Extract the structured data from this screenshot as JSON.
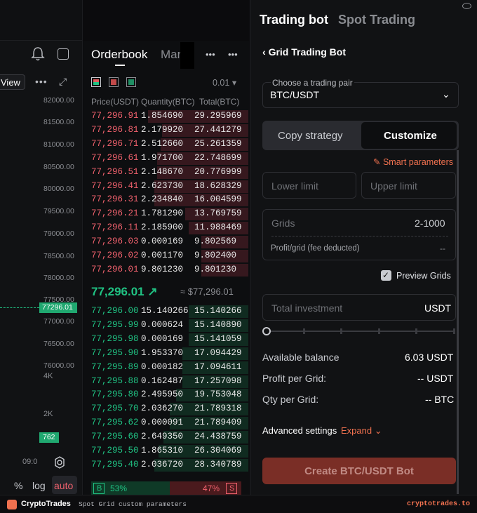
{
  "chart": {
    "view_label": "View",
    "price_labels": [
      "82000.00",
      "81500.00",
      "81000.00",
      "80500.00",
      "80000.00",
      "79500.00",
      "79000.00",
      "78500.00",
      "78000.00",
      "77500.00",
      "77000.00",
      "76500.00",
      "76000.00"
    ],
    "current_tag": "77296.01",
    "volume_labels": [
      "4K",
      "2K"
    ],
    "volume_tag": "762",
    "time_label": "09:0",
    "scale_buttons": [
      "%",
      "log",
      "auto"
    ]
  },
  "orderbook": {
    "tab_active": "Orderbook",
    "tab_other": "Mark",
    "precision": "0.01",
    "columns": [
      "Price(USDT)",
      "Quantity(BTC)",
      "Total(BTC)"
    ],
    "asks": [
      {
        "price": "77,296.91",
        "qty": "1.854690",
        "total": "29.295969",
        "depth": 0.64
      },
      {
        "price": "77,296.81",
        "qty": "2.179920",
        "total": "27.441279",
        "depth": 0.55
      },
      {
        "price": "77,296.71",
        "qty": "2.512660",
        "total": "25.261359",
        "depth": 0.56
      },
      {
        "price": "77,296.61",
        "qty": "1.971700",
        "total": "22.748699",
        "depth": 0.58
      },
      {
        "price": "77,296.51",
        "qty": "2.148670",
        "total": "20.776999",
        "depth": 0.58
      },
      {
        "price": "77,296.41",
        "qty": "2.623730",
        "total": "18.628329",
        "depth": 0.6
      },
      {
        "price": "77,296.31",
        "qty": "2.234840",
        "total": "16.004599",
        "depth": 0.6
      },
      {
        "price": "77,296.21",
        "qty": "1.781290",
        "total": "13.769759",
        "depth": 0.4
      },
      {
        "price": "77,296.11",
        "qty": "2.185900",
        "total": "11.988469",
        "depth": 0.38
      },
      {
        "price": "77,296.03",
        "qty": "0.000169",
        "total": "9.802569",
        "depth": 0.3
      },
      {
        "price": "77,296.02",
        "qty": "0.001170",
        "total": "9.802400",
        "depth": 0.3
      },
      {
        "price": "77,296.01",
        "qty": "9.801230",
        "total": "9.801230",
        "depth": 0.3
      }
    ],
    "last_price": "77,296.01",
    "last_arrow": "↗",
    "last_usd": "≈ $77,296.01",
    "bids": [
      {
        "price": "77,296.00",
        "qty": "15.140266",
        "total": "15.140266",
        "depth": 0.38
      },
      {
        "price": "77,295.99",
        "qty": "0.000624",
        "total": "15.140890",
        "depth": 0.38
      },
      {
        "price": "77,295.98",
        "qty": "0.000169",
        "total": "15.141059",
        "depth": 0.38
      },
      {
        "price": "77,295.90",
        "qty": "1.953370",
        "total": "17.094429",
        "depth": 0.42
      },
      {
        "price": "77,295.89",
        "qty": "0.000182",
        "total": "17.094611",
        "depth": 0.42
      },
      {
        "price": "77,295.88",
        "qty": "0.162487",
        "total": "17.257098",
        "depth": 0.42
      },
      {
        "price": "77,295.80",
        "qty": "2.495950",
        "total": "19.753048",
        "depth": 0.46
      },
      {
        "price": "77,295.70",
        "qty": "2.036270",
        "total": "21.789318",
        "depth": 0.5
      },
      {
        "price": "77,295.62",
        "qty": "0.000091",
        "total": "21.789409",
        "depth": 0.5
      },
      {
        "price": "77,295.60",
        "qty": "2.649350",
        "total": "24.438759",
        "depth": 0.54
      },
      {
        "price": "77,295.50",
        "qty": "1.865310",
        "total": "26.304069",
        "depth": 0.57
      },
      {
        "price": "77,295.40",
        "qty": "2.036720",
        "total": "28.340789",
        "depth": 0.6
      }
    ],
    "buy_label": "B",
    "buy_pct": "53%",
    "sell_pct": "47%",
    "sell_label": "S"
  },
  "panel": {
    "tab_active": "Trading bot",
    "tab_other": "Spot Trading",
    "back_title": "Grid Trading Bot",
    "pair_label": "Choose a trading pair",
    "pair_value": "BTC/USDT",
    "mode_copy": "Copy strategy",
    "mode_custom": "Customize",
    "smart_params": "Smart parameters",
    "lower_placeholder": "Lower limit",
    "upper_placeholder": "Upper limit",
    "grids_label": "Grids",
    "grids_range": "2-1000",
    "profit_grid_label": "Profit/grid (fee deducted)",
    "profit_grid_value": "--",
    "preview_label": "Preview Grids",
    "investment_label": "Total investment",
    "investment_unit": "USDT",
    "available_label": "Available balance",
    "available_value": "6.03 USDT",
    "profit_per_grid_label": "Profit per Grid:",
    "profit_per_grid_value": "-- USDT",
    "qty_per_grid_label": "Qty per Grid:",
    "qty_per_grid_value": "-- BTC",
    "advanced_label": "Advanced settings",
    "expand_label": "Expand",
    "create_button": "Create BTC/USDT Bot"
  },
  "footer": {
    "brand": "CryptoTrades",
    "caption": "Spot Grid custom parameters",
    "site": "cryptotrades.to"
  },
  "colors": {
    "ask": "#f0616d",
    "bid": "#20c283",
    "accent": "#f0714f",
    "create_bg": "#7a2e26"
  }
}
